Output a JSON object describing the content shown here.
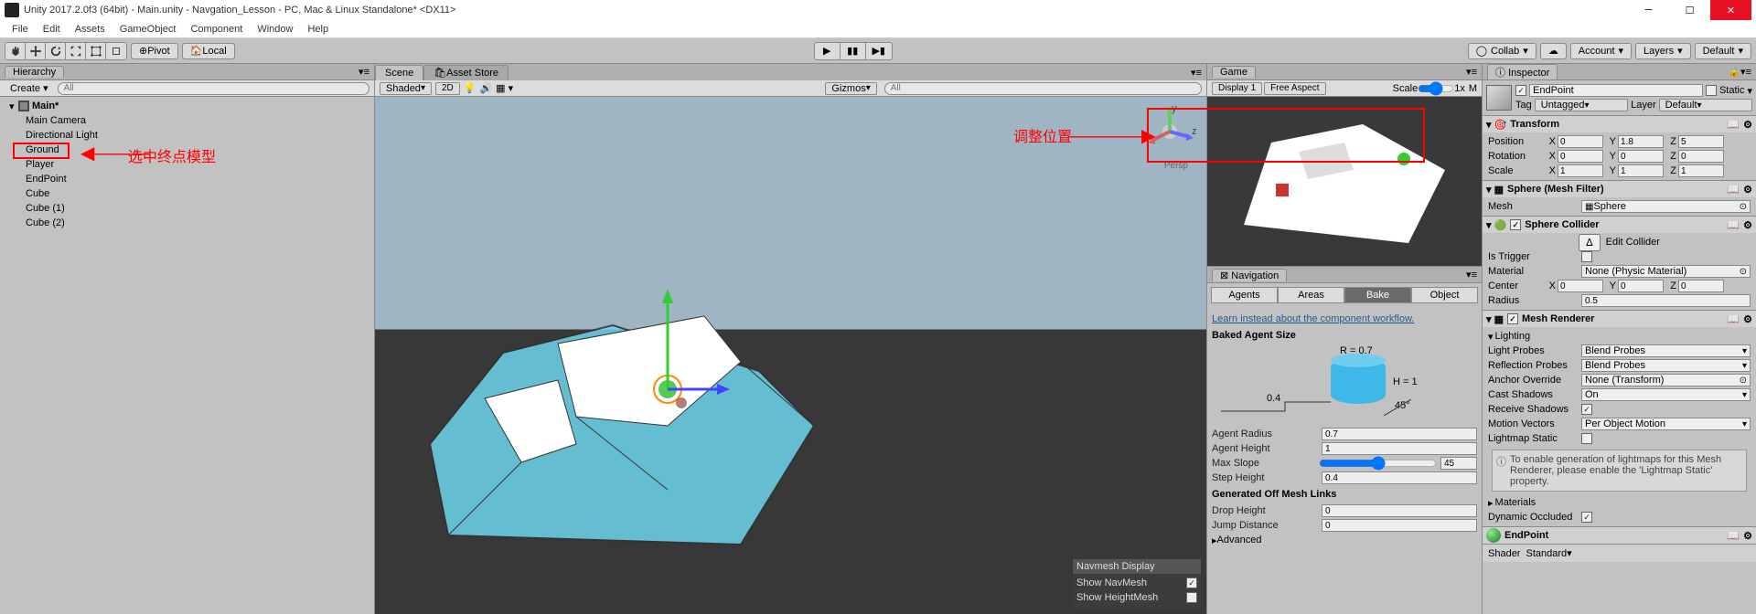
{
  "titlebar": "Unity 2017.2.0f3 (64bit) - Main.unity - Navgation_Lesson - PC, Mac & Linux Standalone* <DX11>",
  "menu": [
    "File",
    "Edit",
    "Assets",
    "GameObject",
    "Component",
    "Window",
    "Help"
  ],
  "toolbar": {
    "pivot": "Pivot",
    "local": "Local",
    "collab": "Collab",
    "account": "Account",
    "layers": "Layers",
    "layout": "Default"
  },
  "hierarchy": {
    "title": "Hierarchy",
    "create": "Create",
    "search_ph": "All",
    "root": "Main*",
    "items": [
      "Main Camera",
      "Directional Light",
      "Ground",
      "Player",
      "EndPoint",
      "Cube",
      "Cube (1)",
      "Cube (2)"
    ],
    "selected": "EndPoint",
    "annotation": "选中终点模型"
  },
  "scene": {
    "tab_scene": "Scene",
    "tab_asset": "Asset Store",
    "shaded": "Shaded",
    "mode2d": "2D",
    "gizmos": "Gizmos",
    "search_ph": "All",
    "persp": "Persp",
    "navmesh_display": "Navmesh Display",
    "show_navmesh": "Show NavMesh",
    "show_heightmesh": "Show HeightMesh"
  },
  "game": {
    "title": "Game",
    "display": "Display 1",
    "aspect": "Free Aspect",
    "scale": "Scale",
    "scale_val": "1x",
    "m": "M",
    "annotation": "调整位置"
  },
  "navigation": {
    "title": "Navigation",
    "tabs": [
      "Agents",
      "Areas",
      "Bake",
      "Object"
    ],
    "active_tab": "Bake",
    "link": "Learn instead about the component workflow.",
    "baked_label": "Baked Agent Size",
    "r_label": "R = 0.7",
    "h_label": "H = 1",
    "deg_label": "45°",
    "step_label": "0.4",
    "agent_radius_l": "Agent Radius",
    "agent_radius_v": "0.7",
    "agent_height_l": "Agent Height",
    "agent_height_v": "1",
    "max_slope_l": "Max Slope",
    "max_slope_v": "45",
    "step_height_l": "Step Height",
    "step_height_v": "0.4",
    "gen_links": "Generated Off Mesh Links",
    "drop_height_l": "Drop Height",
    "drop_height_v": "0",
    "jump_dist_l": "Jump Distance",
    "jump_dist_v": "0",
    "advanced": "Advanced"
  },
  "inspector": {
    "title": "Inspector",
    "name": "EndPoint",
    "static": "Static",
    "tag_l": "Tag",
    "tag_v": "Untagged",
    "layer_l": "Layer",
    "layer_v": "Default",
    "transform": {
      "title": "Transform",
      "position_l": "Position",
      "px": "0",
      "py": "1.8",
      "pz": "5",
      "rotation_l": "Rotation",
      "rx": "0",
      "ry": "0",
      "rz": "0",
      "scale_l": "Scale",
      "sx": "1",
      "sy": "1",
      "sz": "1"
    },
    "mesh_filter": {
      "title": "Sphere (Mesh Filter)",
      "mesh_l": "Mesh",
      "mesh_v": "Sphere"
    },
    "collider": {
      "title": "Sphere Collider",
      "edit_btn": "Edit Collider",
      "is_trigger_l": "Is Trigger",
      "material_l": "Material",
      "material_v": "None (Physic Material)",
      "center_l": "Center",
      "cx": "0",
      "cy": "0",
      "cz": "0",
      "radius_l": "Radius",
      "radius_v": "0.5"
    },
    "renderer": {
      "title": "Mesh Renderer",
      "lighting": "Lighting",
      "light_probes_l": "Light Probes",
      "light_probes_v": "Blend Probes",
      "refl_probes_l": "Reflection Probes",
      "refl_probes_v": "Blend Probes",
      "anchor_l": "Anchor Override",
      "anchor_v": "None (Transform)",
      "shadows_l": "Cast Shadows",
      "shadows_v": "On",
      "recv_shadows_l": "Receive Shadows",
      "motion_l": "Motion Vectors",
      "motion_v": "Per Object Motion",
      "lightmap_l": "Lightmap Static",
      "info": "To enable generation of lightmaps for this Mesh Renderer, please enable the 'Lightmap Static' property.",
      "materials": "Materials",
      "dyn_occ_l": "Dynamic Occluded"
    },
    "material": {
      "name": "EndPoint",
      "shader_l": "Shader",
      "shader_v": "Standard"
    }
  }
}
